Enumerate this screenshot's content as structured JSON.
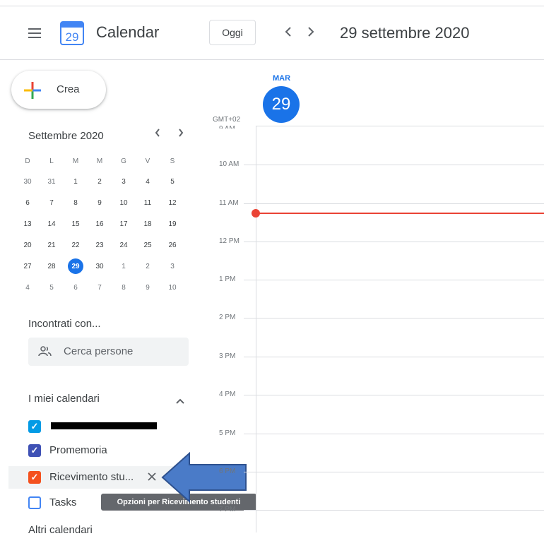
{
  "header": {
    "app_title": "Calendar",
    "logo_day": "29",
    "today_label": "Oggi",
    "date_title": "29 settembre 2020"
  },
  "sidebar": {
    "create_label": "Crea",
    "mini_calendar": {
      "title": "Settembre 2020",
      "weekdays": [
        "D",
        "L",
        "M",
        "M",
        "G",
        "V",
        "S"
      ],
      "weeks": [
        [
          "30",
          "31",
          "1",
          "2",
          "3",
          "4",
          "5"
        ],
        [
          "6",
          "7",
          "8",
          "9",
          "10",
          "11",
          "12"
        ],
        [
          "13",
          "14",
          "15",
          "16",
          "17",
          "18",
          "19"
        ],
        [
          "20",
          "21",
          "22",
          "23",
          "24",
          "25",
          "26"
        ],
        [
          "27",
          "28",
          "29",
          "30",
          "1",
          "2",
          "3"
        ],
        [
          "4",
          "5",
          "6",
          "7",
          "8",
          "9",
          "10"
        ]
      ],
      "selected": "29"
    },
    "meet_title": "Incontrati con...",
    "search_placeholder": "Cerca persone",
    "my_calendars_title": "I miei calendari",
    "calendars": [
      {
        "label": "",
        "color": "#039be5",
        "checked": true,
        "redacted": true
      },
      {
        "label": "Promemoria",
        "color": "#3f51b5",
        "checked": true
      },
      {
        "label": "Ricevimento stu...",
        "color": "#f4511e",
        "checked": true
      },
      {
        "label": "Tasks",
        "color": "#4285f4",
        "checked": false
      }
    ],
    "tooltip": "Opzioni per Ricevimento studenti",
    "other_calendars_partial": "Altri calendari"
  },
  "day_view": {
    "day_name": "MAR",
    "day_number": "29",
    "timezone": "GMT+02",
    "hours": [
      "9 AM",
      "10 AM",
      "11 AM",
      "12 PM",
      "1 PM",
      "2 PM",
      "3 PM",
      "4 PM",
      "5 PM",
      "6 PM",
      "7 PM"
    ],
    "now_indicator_color": "#ea4335"
  },
  "colors": {
    "accent": "#1a73e8",
    "arrow_fill": "#4a7bc8",
    "arrow_stroke": "#2f528f"
  }
}
